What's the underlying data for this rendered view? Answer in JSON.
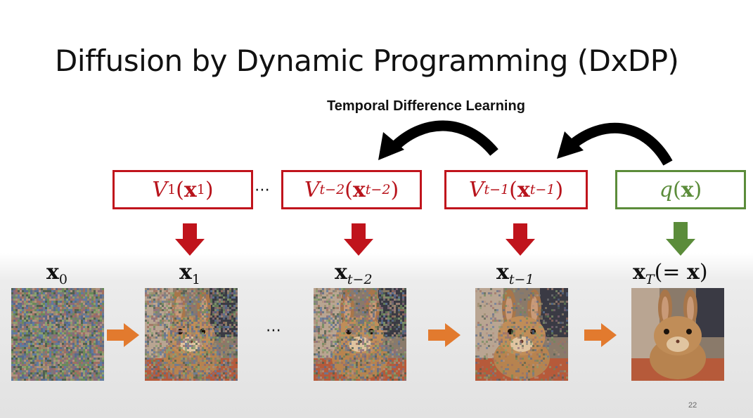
{
  "title": "Diffusion by Dynamic Programming (DxDP)",
  "td_label": "Temporal Difference Learning",
  "value_boxes": [
    {
      "fn": "V",
      "fn_sub": "1",
      "arg": "x",
      "arg_sub": "1"
    },
    {
      "fn": "V",
      "fn_sub": "t−2",
      "arg": "x",
      "arg_sub": "t−2"
    },
    {
      "fn": "V",
      "fn_sub": "t−1",
      "arg": "x",
      "arg_sub": "t−1"
    }
  ],
  "target_box": {
    "fn": "q",
    "arg": "x"
  },
  "ellipsis": "⋯",
  "state_labels": [
    {
      "base": "x",
      "sub": "0"
    },
    {
      "base": "x",
      "sub": "1"
    },
    {
      "base": "x",
      "sub": "t−2"
    },
    {
      "base": "x",
      "sub": "t−1"
    },
    {
      "base": "x",
      "sub": "T",
      "suffix_open": "(= ",
      "suffix_x": "x",
      "suffix_close": ")"
    }
  ],
  "noise_levels": [
    1.0,
    0.6,
    0.55,
    0.25,
    0.0
  ],
  "colors": {
    "value_box": "#c0141c",
    "target_box": "#5b8c3a",
    "transition_arrow": "#e27a2e",
    "backup_arrow": "#000000"
  },
  "slide_number": "22"
}
